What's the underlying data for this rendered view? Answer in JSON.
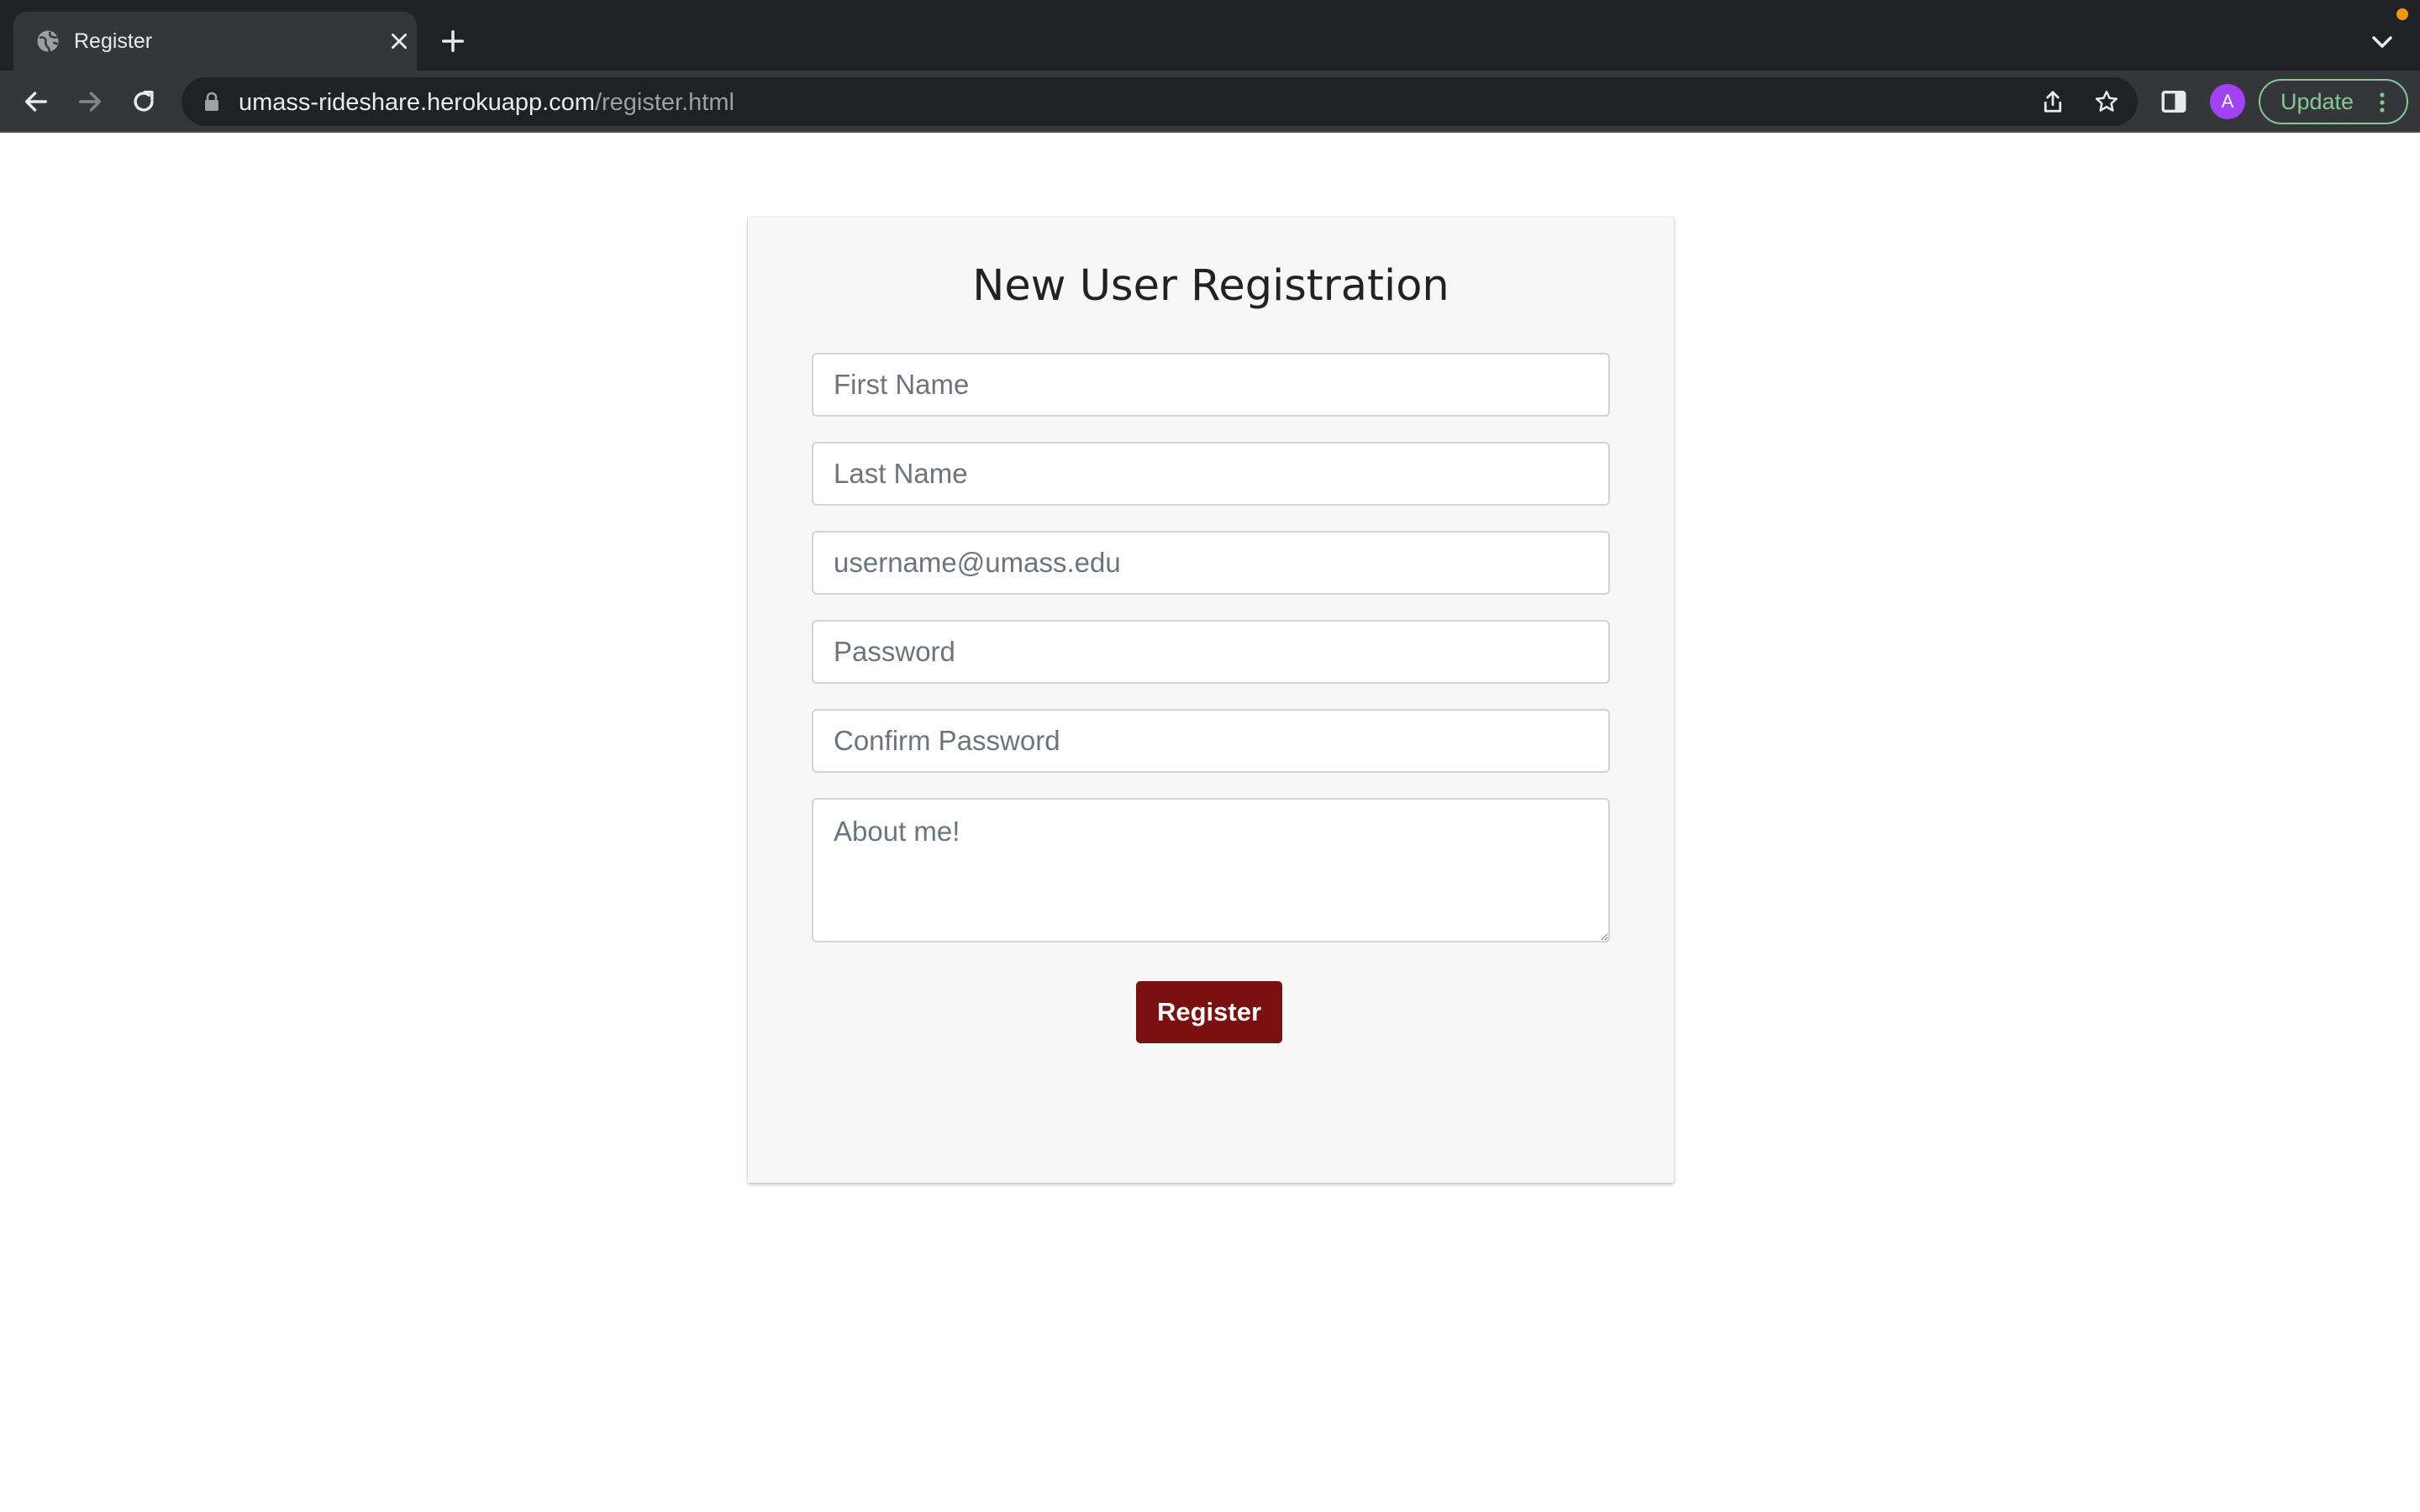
{
  "browser": {
    "tab": {
      "title": "Register",
      "favicon": "globe-icon",
      "close_icon": "close-icon"
    },
    "new_tab_icon": "plus-icon",
    "tab_search_icon": "chevron-down-icon",
    "nav": {
      "back_icon": "back-arrow-icon",
      "forward_icon": "forward-arrow-icon",
      "reload_icon": "reload-icon"
    },
    "address_bar": {
      "host": "umass-rideshare.herokuapp.com",
      "path": "/register.html",
      "lock_icon": "lock-icon",
      "share_icon": "share-icon",
      "bookmark_icon": "star-icon"
    },
    "side_panel_icon": "side-panel-icon",
    "profile": {
      "initial": "A",
      "color": "#a142f4"
    },
    "update_button": {
      "label": "Update",
      "color": "#81c995"
    },
    "menu_icon": "kebab-menu-icon"
  },
  "form": {
    "title": "New User Registration",
    "first_name": {
      "placeholder": "First Name",
      "value": ""
    },
    "last_name": {
      "placeholder": "Last Name",
      "value": ""
    },
    "email": {
      "placeholder": "username@umass.edu",
      "value": ""
    },
    "password": {
      "placeholder": "Password",
      "value": ""
    },
    "confirm_password": {
      "placeholder": "Confirm Password",
      "value": ""
    },
    "about": {
      "placeholder": "About me!",
      "value": ""
    },
    "submit": {
      "label": "Register",
      "color": "#7a1010"
    }
  }
}
